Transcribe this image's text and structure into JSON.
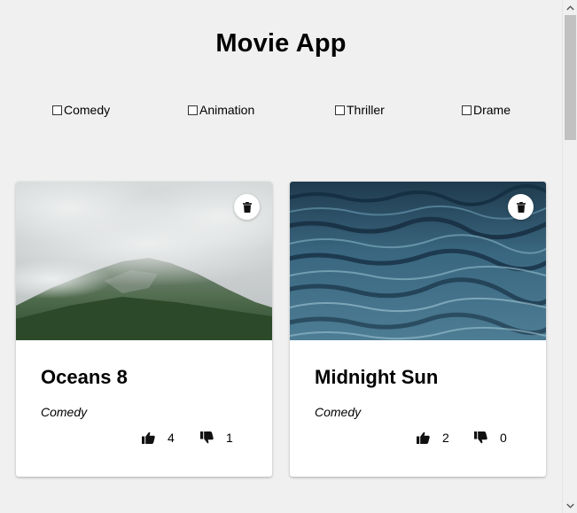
{
  "app": {
    "title": "Movie App"
  },
  "filters": [
    {
      "label": "Comedy",
      "checked": false
    },
    {
      "label": "Animation",
      "checked": false
    },
    {
      "label": "Thriller",
      "checked": false
    },
    {
      "label": "Drame",
      "checked": false
    }
  ],
  "movies": [
    {
      "title": "Oceans 8",
      "genre": "Comedy",
      "likes": "4",
      "dislikes": "1",
      "image": "misty-mountain-image"
    },
    {
      "title": "Midnight Sun",
      "genre": "Comedy",
      "likes": "2",
      "dislikes": "0",
      "image": "ocean-waves-image"
    }
  ],
  "icons": {
    "delete": "trash-icon",
    "like": "thumbs-up-icon",
    "dislike": "thumbs-down-icon",
    "scroll_up": "chevron-up-icon",
    "scroll_down": "chevron-down-icon"
  }
}
